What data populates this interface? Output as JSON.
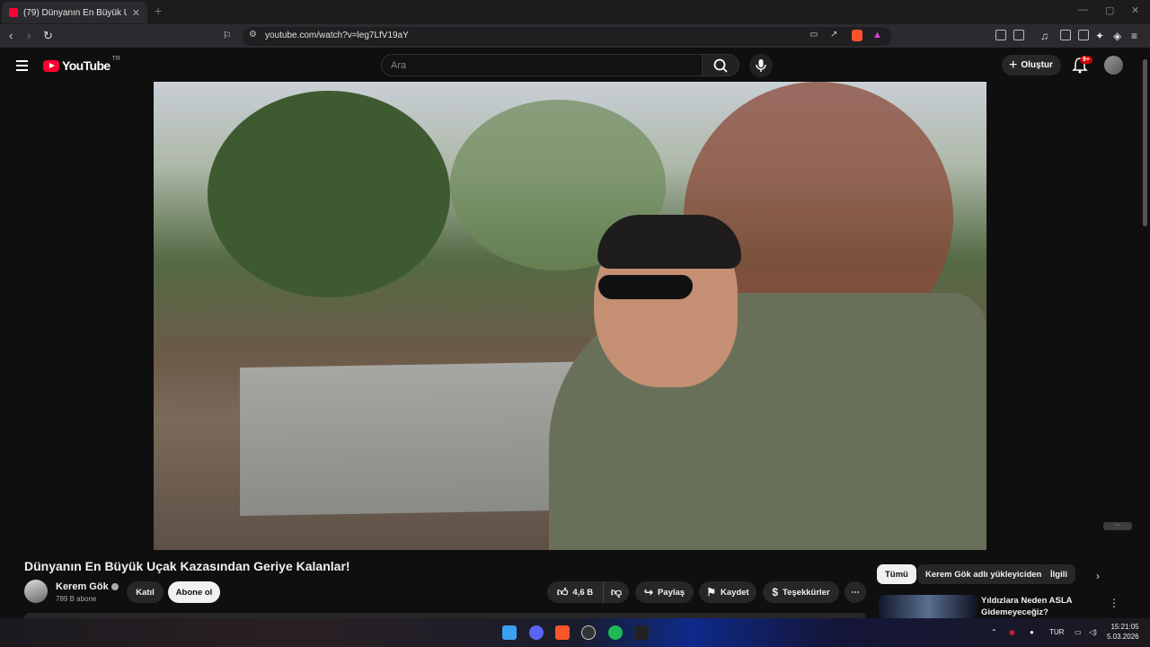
{
  "browser": {
    "tab_title": "(79) Dünyanın En Büyük Uçak Ka",
    "url": "youtube.com/watch?v=leg7LfV19aY"
  },
  "youtube": {
    "logo": "YouTube",
    "country": "TR",
    "search_placeholder": "Ara",
    "create_label": "Oluştur",
    "notifications_badge": "9+"
  },
  "video": {
    "title": "Dünyanın En Büyük Uçak Kazasından Geriye Kalanlar!",
    "channel": "Kerem Gök",
    "subscribers": "789 B abone",
    "join_label": "Katıl",
    "subscribe_label": "Abone ol",
    "likes": "4,6 B",
    "share_label": "Paylaş",
    "save_label": "Kaydet",
    "thanks_label": "Teşekkürler"
  },
  "sidebar": {
    "chips": [
      "Tümü",
      "Kerem Gök adlı yükleyiciden",
      "İlgili"
    ],
    "recommendation_title": "Yıldızlara Neden ASLA Gidemeyeceğiz?"
  },
  "taskbar": {
    "language": "TUR",
    "time": "15:21:05",
    "date": "5.03.2026"
  }
}
